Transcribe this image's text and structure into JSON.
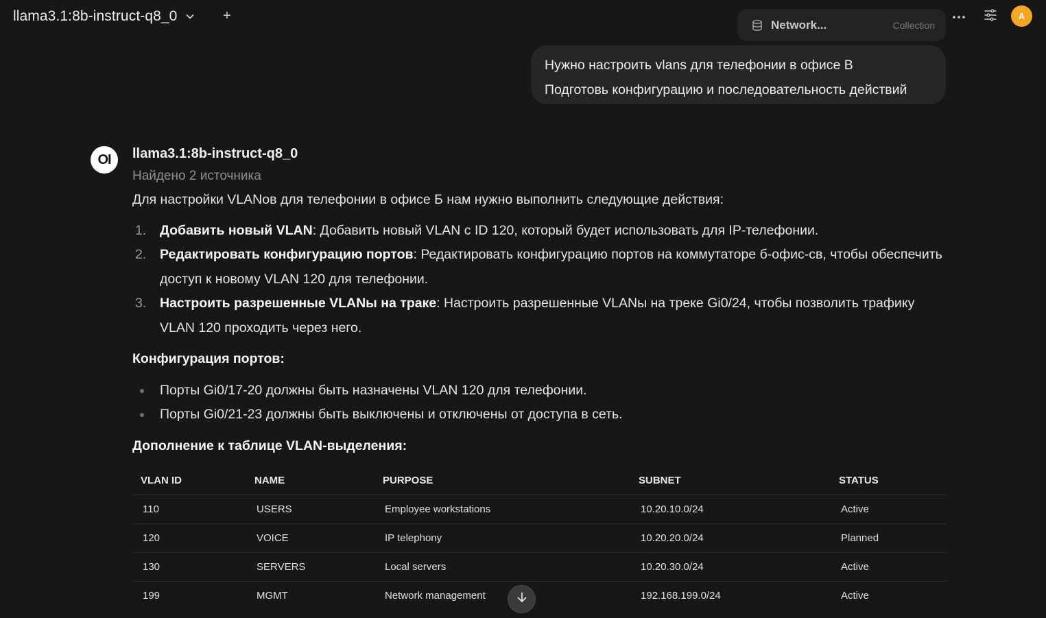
{
  "header": {
    "model_name": "llama3.1:8b-instruct-q8_0",
    "new_chat_symbol": "+",
    "user_initial": "A"
  },
  "knowledge": {
    "collection_name": "Network...",
    "collection_type": "Collection"
  },
  "user_message": {
    "line1": "Нужно настроить vlans для телефонии в офисе B",
    "line2": "Подготовь конфигурацию и последовательность действий"
  },
  "assistant": {
    "avatar_text": "OI",
    "model_name": "llama3.1:8b-instruct-q8_0",
    "sources_text": "Найдено 2 источника",
    "intro": "Для настройки VLANов для телефонии в офисе Б нам нужно выполнить следующие действия:",
    "steps": [
      {
        "number": "1.",
        "title": "Добавить новый VLAN",
        "text": ": Добавить новый VLAN с ID 120, который будет использовать для IP-телефонии."
      },
      {
        "number": "2.",
        "title": "Редактировать конфигурацию портов",
        "text": ": Редактировать конфигурацию портов на коммутаторе б-офис-св, чтобы обеспечить доступ к новому VLAN 120 для телефонии."
      },
      {
        "number": "3.",
        "title": "Настроить разрешенные VLANы на траке",
        "text": ": Настроить разрешенные VLANы на треке Gi0/24, чтобы позволить трафику VLAN 120 проходить через него."
      }
    ],
    "ports_heading": "Конфигурация портов:",
    "ports": [
      "Порты Gi0/17-20 должны быть назначены VLAN 120 для телефонии.",
      "Порты Gi0/21-23 должны быть выключены и отключены от доступа в сеть."
    ],
    "table_heading": "Дополнение к таблице VLAN-выделения:",
    "table": {
      "headers": [
        "VLAN ID",
        "NAME",
        "PURPOSE",
        "SUBNET",
        "STATUS"
      ],
      "rows": [
        [
          "110",
          "USERS",
          "Employee workstations",
          "10.20.10.0/24",
          "Active"
        ],
        [
          "120",
          "VOICE",
          "IP telephony",
          "10.20.20.0/24",
          "Planned"
        ],
        [
          "130",
          "SERVERS",
          "Local servers",
          "10.20.30.0/24",
          "Active"
        ],
        [
          "199",
          "MGMT",
          "Network management",
          "192.168.199.0/24",
          "Active"
        ]
      ]
    }
  },
  "colors": {
    "background": "#171717",
    "bubble": "#262626",
    "avatar_accent": "#f5a623"
  },
  "icons": {
    "model_dropdown": "chevron-down-icon",
    "more": "ellipsis-icon",
    "controls": "sliders-icon",
    "collection": "database-icon",
    "scroll": "arrow-down-icon"
  }
}
